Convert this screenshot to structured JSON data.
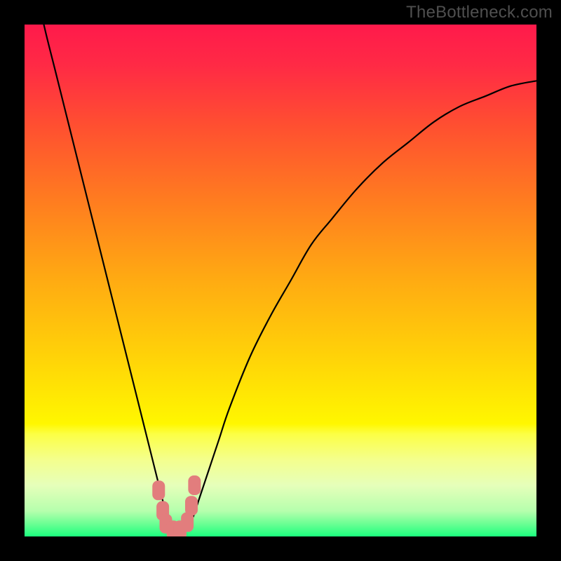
{
  "watermark": "TheBottleneck.com",
  "chart_data": {
    "type": "line",
    "title": "",
    "xlabel": "",
    "ylabel": "",
    "xlim": [
      0,
      100
    ],
    "ylim": [
      0,
      100
    ],
    "background_gradient_stops": [
      {
        "offset": 0.0,
        "color": "#ff1a4b"
      },
      {
        "offset": 0.08,
        "color": "#ff2a45"
      },
      {
        "offset": 0.2,
        "color": "#ff5030"
      },
      {
        "offset": 0.35,
        "color": "#ff7e1f"
      },
      {
        "offset": 0.5,
        "color": "#ffab12"
      },
      {
        "offset": 0.65,
        "color": "#ffd308"
      },
      {
        "offset": 0.78,
        "color": "#fff700"
      },
      {
        "offset": 0.8,
        "color": "#fcff45"
      },
      {
        "offset": 0.85,
        "color": "#f4ff8d"
      },
      {
        "offset": 0.9,
        "color": "#e6ffba"
      },
      {
        "offset": 0.95,
        "color": "#b6ffad"
      },
      {
        "offset": 0.975,
        "color": "#6cff94"
      },
      {
        "offset": 1.0,
        "color": "#1cff7e"
      }
    ],
    "series": [
      {
        "name": "bottleneck-curve",
        "x": [
          0,
          2,
          4,
          6,
          8,
          10,
          12,
          14,
          16,
          18,
          20,
          22,
          24,
          25,
          26,
          27,
          28,
          29,
          30,
          31,
          32,
          33,
          34,
          36,
          38,
          40,
          44,
          48,
          52,
          56,
          60,
          65,
          70,
          75,
          80,
          85,
          90,
          95,
          100
        ],
        "y": [
          118,
          108,
          99,
          91,
          83,
          75,
          67,
          59,
          51,
          43,
          35,
          27,
          19,
          15,
          11,
          7,
          4,
          2,
          1,
          1,
          2,
          4,
          7,
          13,
          19,
          25,
          35,
          43,
          50,
          57,
          62,
          68,
          73,
          77,
          81,
          84,
          86,
          88,
          89
        ]
      }
    ],
    "bottom_markers": {
      "color": "#e27d7d",
      "points": [
        {
          "x": 26.2,
          "y": 9
        },
        {
          "x": 27.0,
          "y": 5
        },
        {
          "x": 27.6,
          "y": 2.5
        },
        {
          "x": 29.0,
          "y": 1.2
        },
        {
          "x": 30.4,
          "y": 1.2
        },
        {
          "x": 31.8,
          "y": 2.8
        },
        {
          "x": 32.6,
          "y": 6
        },
        {
          "x": 33.2,
          "y": 10
        }
      ]
    }
  }
}
